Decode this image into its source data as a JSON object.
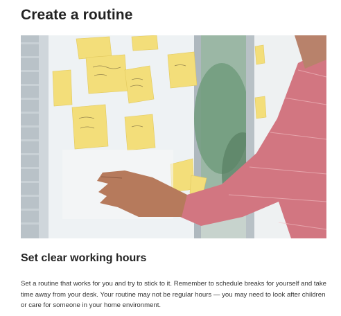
{
  "page": {
    "title": "Create a routine"
  },
  "hero_image": {
    "description_icon": "photo-office-sticky-notes",
    "colors": {
      "glass": "#e8eef2",
      "frame": "#c7cfd4",
      "sticky_note": "#f3de7a",
      "shirt": "#d4707a",
      "skin": "#b47a5e"
    }
  },
  "section": {
    "heading": "Set clear working hours",
    "body": "Set a routine that works for you and try to stick to it. Remember to schedule breaks for yourself and take time away from your desk. Your routine may not be regular hours — you may need to look after children or care for someone in your home environment."
  }
}
